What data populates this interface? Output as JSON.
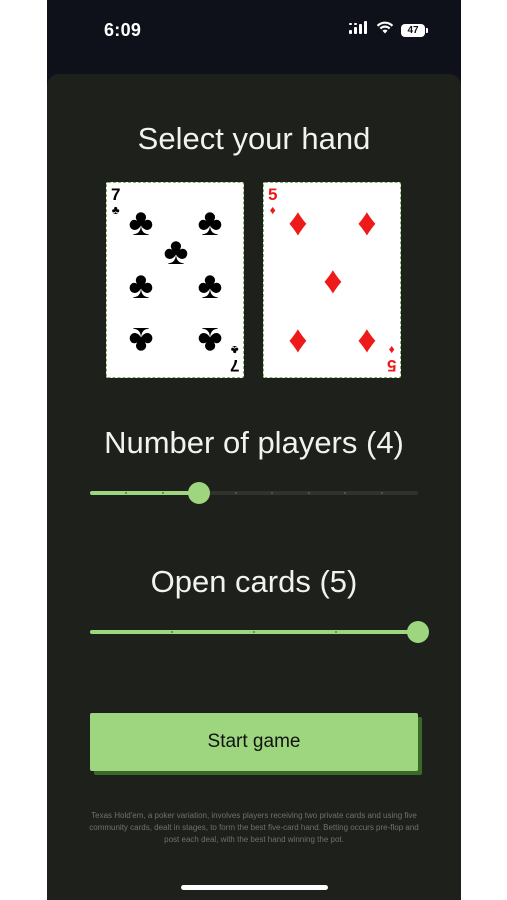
{
  "status_bar": {
    "time": "6:09",
    "battery_level": "47",
    "icons": [
      "signal-icon",
      "wifi-icon",
      "battery-icon"
    ]
  },
  "hand": {
    "title": "Select your hand",
    "cards": [
      {
        "rank": "7",
        "suit": "clubs",
        "suit_glyph": "♣",
        "color": "#000000"
      },
      {
        "rank": "5",
        "suit": "diamonds",
        "suit_glyph": "♦",
        "color": "#ee1a1a"
      }
    ]
  },
  "players": {
    "title": "Number of players (4)",
    "value": 4,
    "min": 1,
    "max": 10
  },
  "open_cards": {
    "title": "Open cards (5)",
    "value": 5,
    "min": 1,
    "max": 5
  },
  "start_button": {
    "label": "Start game"
  },
  "description": "Texas Hold'em, a poker variation, involves players receiving two private cards and using five community cards, dealt in stages, to form the best five-card hand. Betting occurs pre-flop and post each deal, with the best hand winning the pot.",
  "colors": {
    "accent": "#9ed57f",
    "accent_shadow": "#3a6b26",
    "background": "#1d201b",
    "text": "#f2f2ee"
  }
}
